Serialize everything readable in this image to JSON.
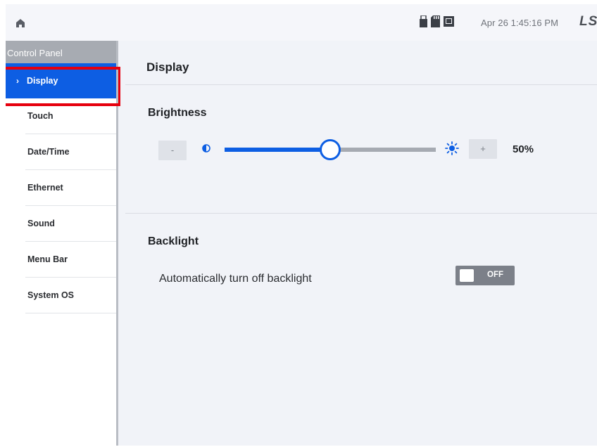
{
  "topbar": {
    "icons": [
      "usb-icon",
      "sd-card-icon",
      "screen-icon"
    ],
    "clock": "Apr 26 1:45:16 PM",
    "brand": "LS"
  },
  "sidebar": {
    "header": "Control Panel",
    "items": [
      {
        "label": "Display",
        "selected": true
      },
      {
        "label": "Touch"
      },
      {
        "label": "Date/Time"
      },
      {
        "label": "Ethernet"
      },
      {
        "label": "Sound"
      },
      {
        "label": "Menu Bar"
      },
      {
        "label": "System OS"
      }
    ]
  },
  "main": {
    "title": "Display",
    "brightness": {
      "title": "Brightness",
      "minus_label": "-",
      "plus_label": "+",
      "value": 50,
      "value_text": "50%"
    },
    "backlight": {
      "title": "Backlight",
      "setting_label": "Automatically turn off backlight",
      "toggle_state": "OFF"
    }
  },
  "colors": {
    "accent": "#0d5ee3",
    "highlight": "#e6000e"
  }
}
